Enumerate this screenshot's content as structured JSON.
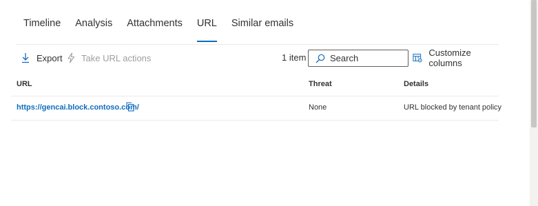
{
  "tabs": [
    {
      "label": "Timeline"
    },
    {
      "label": "Analysis"
    },
    {
      "label": "Attachments"
    },
    {
      "label": "URL"
    },
    {
      "label": "Similar emails"
    }
  ],
  "active_tab": "URL",
  "toolbar": {
    "export_label": "Export",
    "url_actions_label": "Take URL actions",
    "item_count": "1 item",
    "search_placeholder": "Search",
    "customize_label": "Customize columns"
  },
  "table": {
    "columns": [
      "URL",
      "Threat",
      "Details"
    ],
    "rows": [
      {
        "url": "https://gencai.block.contoso.com/",
        "threat": "None",
        "details": "URL blocked by tenant policy"
      }
    ]
  },
  "colors": {
    "accent": "#0f6cbd",
    "disabled": "#a19f9d"
  },
  "icons": [
    "download-icon",
    "lightning-icon",
    "search-icon",
    "customize-columns-icon",
    "copy-icon"
  ]
}
